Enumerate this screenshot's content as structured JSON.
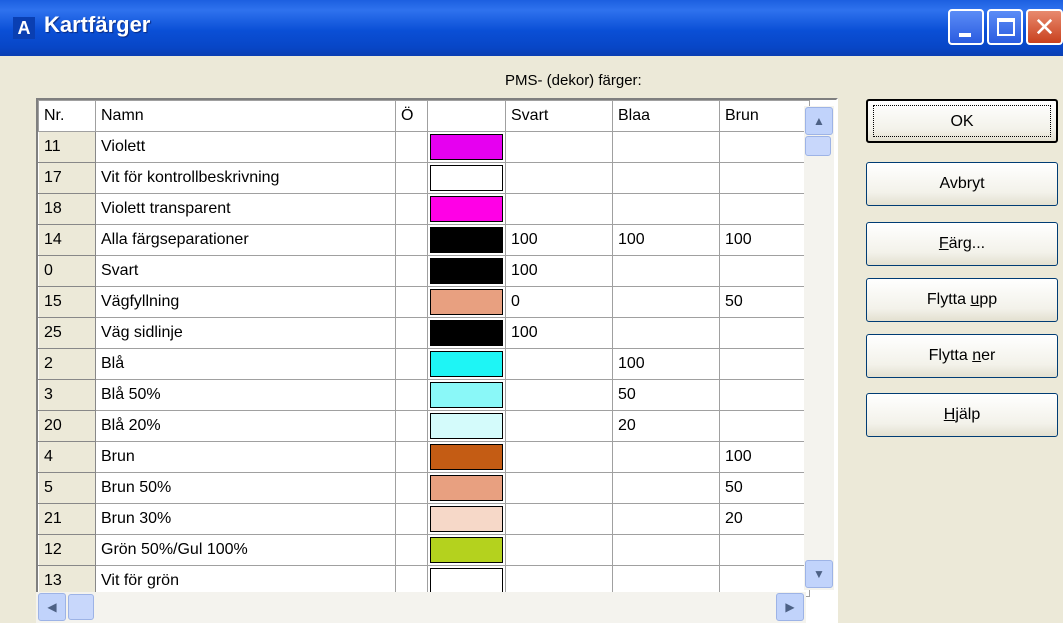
{
  "window": {
    "title": "Kartfärger",
    "app_icon": "A"
  },
  "titlebar_buttons": [
    {
      "name": "minimize-button",
      "icon": "minimize-icon"
    },
    {
      "name": "maximize-button",
      "icon": "maximize-icon"
    },
    {
      "name": "close-button",
      "icon": "close-icon"
    }
  ],
  "section_label": "PMS- (dekor) färger:",
  "table": {
    "headers": [
      "Nr.",
      "Namn",
      "Ö",
      "",
      "Svart",
      "Blaa",
      "Brun"
    ],
    "rows": [
      {
        "nr": "11",
        "name": "Violett",
        "o": "",
        "color": "#e600f0",
        "svart": "",
        "blaa": "",
        "brun": ""
      },
      {
        "nr": "17",
        "name": "Vit för kontrollbeskrivning",
        "o": "",
        "color": "#ffffff",
        "svart": "",
        "blaa": "",
        "brun": ""
      },
      {
        "nr": "18",
        "name": "Violett transparent",
        "o": "",
        "color": "#ff00e6",
        "svart": "",
        "blaa": "",
        "brun": ""
      },
      {
        "nr": "14",
        "name": "Alla färgseparationer",
        "o": "",
        "color": "#000000",
        "svart": "100",
        "blaa": "100",
        "brun": "100"
      },
      {
        "nr": "0",
        "name": "Svart",
        "o": "",
        "color": "#000000",
        "svart": "100",
        "blaa": "",
        "brun": ""
      },
      {
        "nr": "15",
        "name": "Vägfyllning",
        "o": "",
        "color": "#e8a080",
        "svart": "0",
        "blaa": "",
        "brun": "50"
      },
      {
        "nr": "25",
        "name": "Väg sidlinje",
        "o": "",
        "color": "#000000",
        "svart": "100",
        "blaa": "",
        "brun": ""
      },
      {
        "nr": "2",
        "name": "Blå",
        "o": "",
        "color": "#1ef5f5",
        "svart": "",
        "blaa": "100",
        "brun": ""
      },
      {
        "nr": "3",
        "name": "Blå 50%",
        "o": "",
        "color": "#8af8f8",
        "svart": "",
        "blaa": "50",
        "brun": ""
      },
      {
        "nr": "20",
        "name": "Blå 20%",
        "o": "",
        "color": "#d4fbfb",
        "svart": "",
        "blaa": "20",
        "brun": ""
      },
      {
        "nr": "4",
        "name": "Brun",
        "o": "",
        "color": "#c45c14",
        "svart": "",
        "blaa": "",
        "brun": "100"
      },
      {
        "nr": "5",
        "name": "Brun 50%",
        "o": "",
        "color": "#e8a080",
        "svart": "",
        "blaa": "",
        "brun": "50"
      },
      {
        "nr": "21",
        "name": "Brun 30%",
        "o": "",
        "color": "#f6d8c8",
        "svart": "",
        "blaa": "",
        "brun": "20"
      },
      {
        "nr": "12",
        "name": "Grön 50%/Gul 100%",
        "o": "",
        "color": "#b4d21e",
        "svart": "",
        "blaa": "",
        "brun": ""
      },
      {
        "nr": "13",
        "name": "Vit för grön",
        "o": "",
        "color": "#ffffff",
        "svart": "",
        "blaa": "",
        "brun": ""
      }
    ]
  },
  "buttons": {
    "ok": "OK",
    "cancel": "Avbryt",
    "color_pre": "",
    "color_key": "F",
    "color_post": "ärg...",
    "move_up_pre": "Flytta ",
    "move_up_key": "u",
    "move_up_post": "pp",
    "move_down_pre": "Flytta ",
    "move_down_key": "n",
    "move_down_post": "er",
    "help_pre": "",
    "help_key": "H",
    "help_post": "jälp"
  },
  "scroll_icons": {
    "up": "▲",
    "down": "▼",
    "left": "◀",
    "right": "▶"
  }
}
